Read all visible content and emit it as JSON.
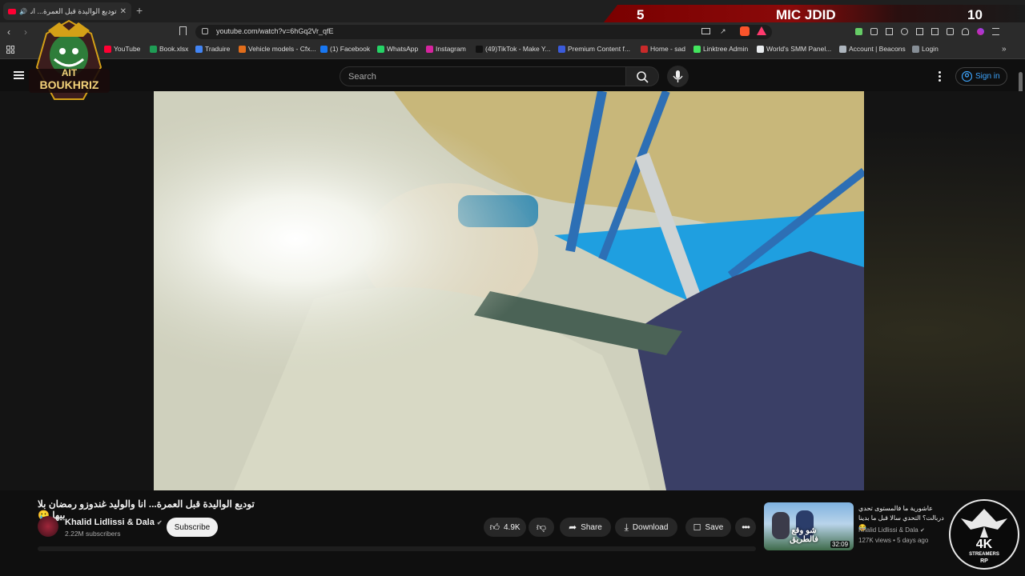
{
  "browser": {
    "tab_title": "توديع الواليدة قبل العمرة... انا و",
    "new_tab": "+",
    "url": "youtube.com/watch?v=6hGq2Vr_qfE",
    "bookmarks": [
      {
        "label": "YouTube",
        "color": "#ff0033"
      },
      {
        "label": "Book.xlsx",
        "color": "#1f9d55"
      },
      {
        "label": "Traduire",
        "color": "#4285f4"
      },
      {
        "label": "Vehicle models - Cfx...",
        "color": "#e26d1b"
      },
      {
        "label": "(1) Facebook",
        "color": "#1877f2"
      },
      {
        "label": "WhatsApp",
        "color": "#25d366"
      },
      {
        "label": "Instagram",
        "color": "#d6249f"
      },
      {
        "label": "(49)TikTok - Make Y...",
        "color": "#111111"
      },
      {
        "label": "Premium Content f...",
        "color": "#3b5bdb"
      },
      {
        "label": "Home - sad",
        "color": "#c92a2a"
      },
      {
        "label": "Linktree Admin",
        "color": "#43e55e"
      },
      {
        "label": "World's SMM Panel...",
        "color": "#e9ecef"
      },
      {
        "label": "Account | Beacons",
        "color": "#adb5bd"
      },
      {
        "label": "Login",
        "color": "#868e96"
      }
    ]
  },
  "overlay": {
    "score_left": "5",
    "team_name": "MIC JDID",
    "score_right": "10",
    "logo_left_line1": "AIT",
    "logo_left_line2": "BOUKHRIZ",
    "logo_right_line1": "4K",
    "logo_right_line2": "STREAMERS",
    "logo_right_line3": "RP"
  },
  "youtube": {
    "search_placeholder": "Search",
    "sign_in": "Sign in",
    "video_title": "توديع الواليدة قبل العمرة... انا والوليد غندوزو رمضان بلا بيها 🥲",
    "channel_name": "Khalid Lidlissi & Dala",
    "subscribers": "2.22M subscribers",
    "subscribe": "Subscribe",
    "likes": "4.9K",
    "share": "Share",
    "download": "Download",
    "save": "Save",
    "recommended": {
      "title": "عاشورية ما فالمستوى تحدي دربالت؟ التحدي سالا قبل ما بدينا 😂",
      "channel": "Khalid Lidlissi & Dala",
      "meta": "127K views • 5 days ago",
      "duration": "32:09",
      "thumb_text": "شو وقع فالطريق"
    }
  },
  "colors": {
    "accent_red": "#ff0033",
    "link_blue": "#3ea6ff",
    "score_red": "#8a0a0a"
  }
}
